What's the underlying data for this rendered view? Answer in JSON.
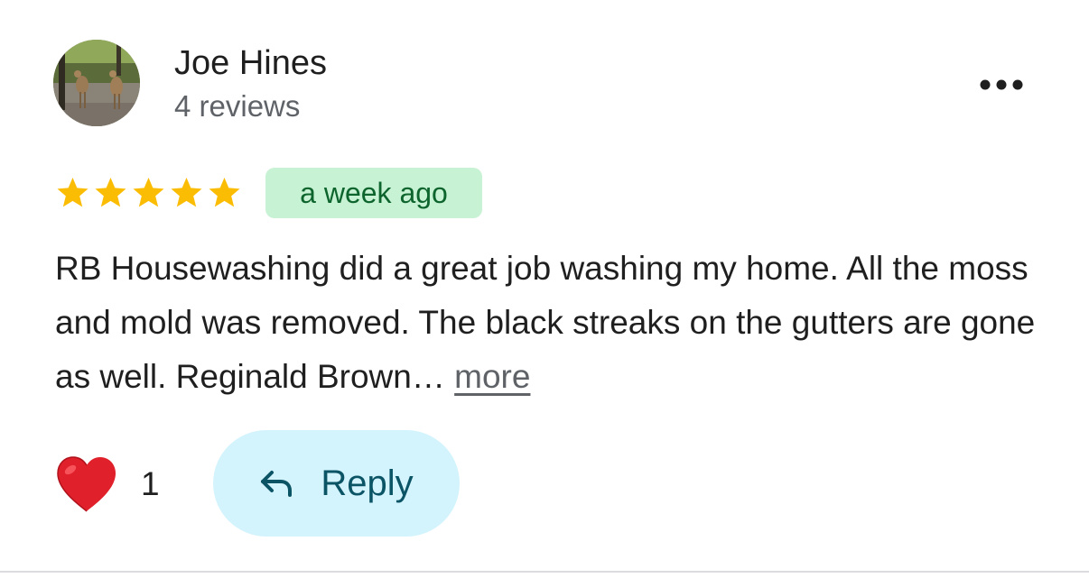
{
  "author": {
    "name": "Joe Hines",
    "review_count": "4 reviews",
    "avatar_icon": "deer-photo-avatar"
  },
  "menu": {
    "icon": "more-horizontal-icon"
  },
  "rating": {
    "stars": 5,
    "max_stars": 5,
    "star_color": "#fbbc04"
  },
  "time_ago": "a week ago",
  "review": {
    "text": "RB Housewashing did a great job washing my home.  All the moss and mold was removed.  The black streaks on the gutters are gone as well.  Reginald Brown…",
    "more_label": "more"
  },
  "reactions": {
    "icon": "heart-icon",
    "count": "1"
  },
  "reply": {
    "icon": "reply-arrow-icon",
    "label": "Reply"
  },
  "colors": {
    "badge_bg": "#c8f2d4",
    "badge_text": "#0d652d",
    "reply_bg": "#d3f3fd",
    "reply_text": "#0b5466",
    "heart": "#e0202a"
  }
}
